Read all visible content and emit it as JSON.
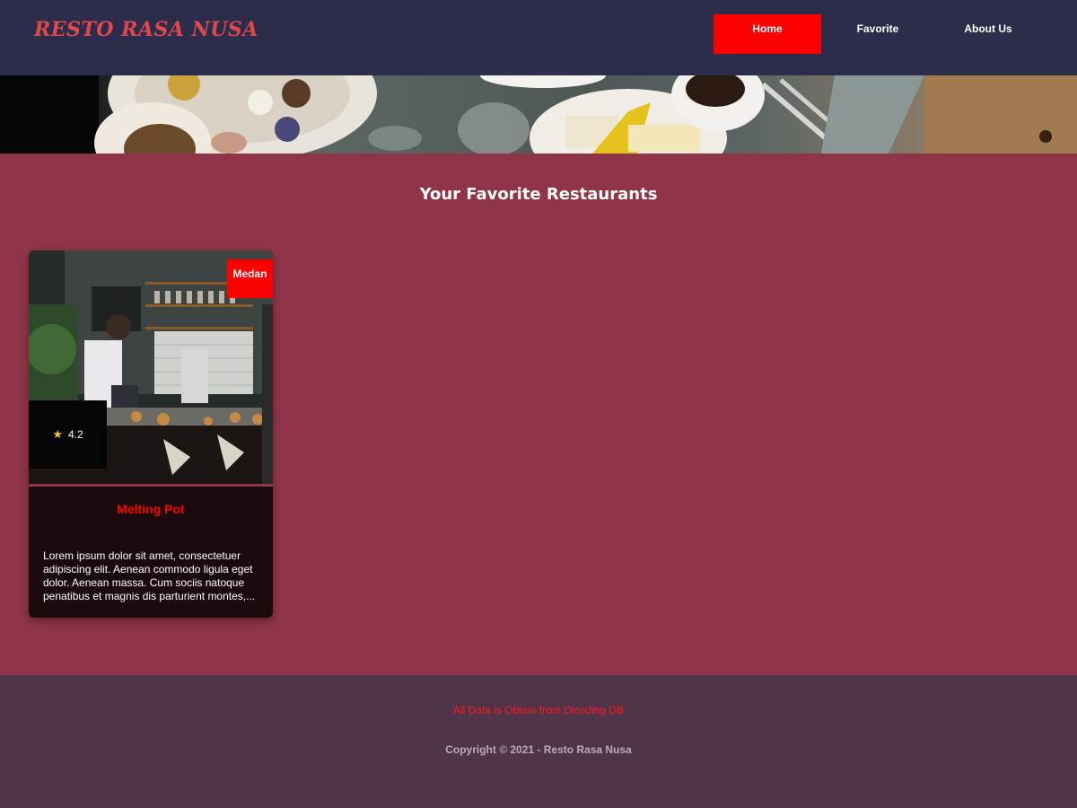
{
  "header": {
    "brand": "RESTO RASA NUSA",
    "nav": [
      {
        "label": "Home",
        "active": true
      },
      {
        "label": "Favorite",
        "active": false
      },
      {
        "label": "About Us",
        "active": false
      }
    ],
    "colors": {
      "background": "#2b2d4b",
      "brand": "#e0484d",
      "active_nav": "#ff0000"
    }
  },
  "main": {
    "title": "Your Favorite Restaurants",
    "background": "#903548",
    "restaurants": [
      {
        "city": "Medan",
        "rating": "4.2",
        "rating_icon": "star-icon",
        "name": "Melting Pot",
        "description": "Lorem ipsum dolor sit amet, consectetuer adipiscing elit. Aenean commodo ligula eget dolor. Aenean massa. Cum sociis natoque penatibus et magnis dis parturient montes,..."
      }
    ]
  },
  "footer": {
    "source": "All Data is Obtain from Dicoding DB",
    "copyright": "Copyright © 2021 - Resto Rasa Nusa",
    "background": "#51334a"
  }
}
